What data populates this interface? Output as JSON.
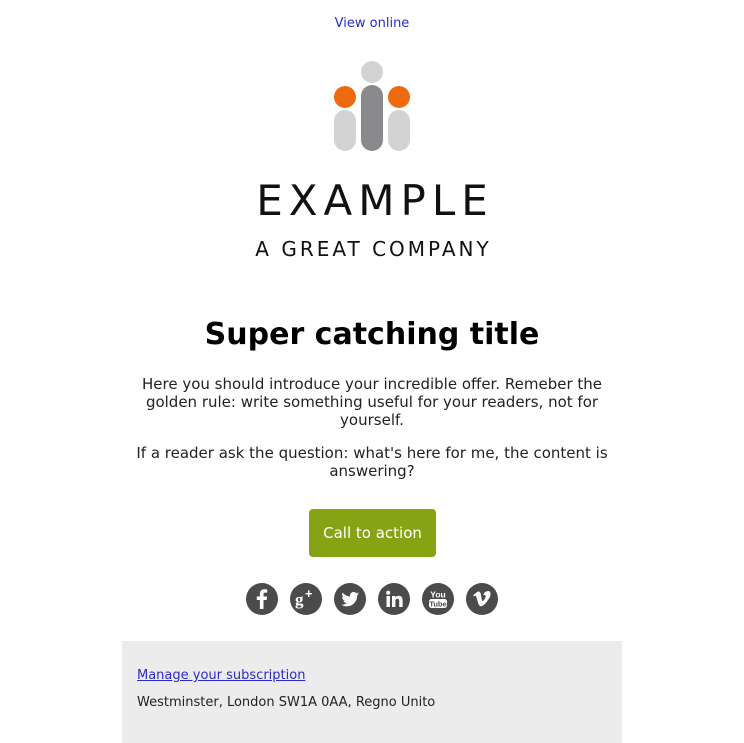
{
  "header": {
    "view_online": "View online"
  },
  "logo": {
    "wordmark": "EXAMPLE",
    "tagline": "A GREAT COMPANY",
    "colors": {
      "orange": "#ee6a0f",
      "dark_gray": "#8a8a8c",
      "light_gray": "#d3d3d3"
    }
  },
  "content": {
    "title": "Super catching title",
    "paragraph_1": "Here you should introduce your incredible offer. Remeber the golden rule: write something useful for your readers, not for yourself.",
    "paragraph_2": "If a reader ask the question: what's here for me, the content is answering?",
    "cta_label": "Call to action",
    "cta_color": "#86a313"
  },
  "social": {
    "icons": [
      "facebook-icon",
      "google-plus-icon",
      "twitter-icon",
      "linkedin-icon",
      "youtube-icon",
      "vimeo-icon"
    ],
    "youtube_text": "You Tube",
    "icon_color": "#4b4b4b"
  },
  "footer": {
    "manage_link": "Manage your subscription",
    "address": "Westminster, London SW1A 0AA, Regno Unito",
    "background": "#ececec"
  }
}
